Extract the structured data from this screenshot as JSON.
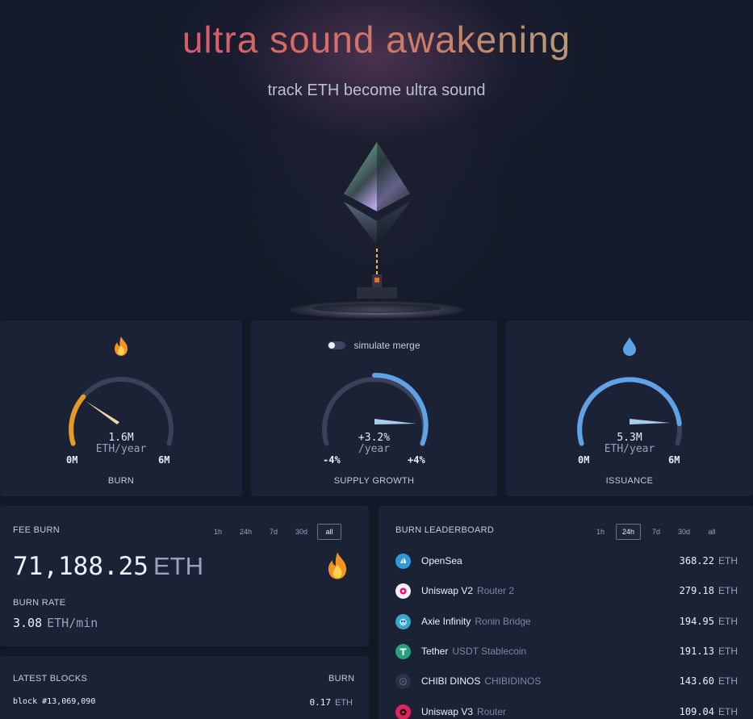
{
  "hero": {
    "title": "ultra sound awakening",
    "subtitle": "track ETH become ultra sound"
  },
  "burn_gauge": {
    "icon": "flame-icon",
    "value": "1.6M",
    "unit": "ETH/year",
    "min": "0M",
    "max": "6M",
    "label": "BURN",
    "fill_fraction": 0.27,
    "color": "#e79a22"
  },
  "supply_gauge": {
    "toggle_label": "simulate merge",
    "toggle_on": false,
    "value": "+3.2%",
    "unit": "/year",
    "min": "-4%",
    "max": "+4%",
    "label": "SUPPLY GROWTH",
    "fill_fraction": 0.9,
    "color": "#5fa2e6"
  },
  "issuance_gauge": {
    "icon": "droplet-icon",
    "value": "5.3M",
    "unit": "ETH/year",
    "min": "0M",
    "max": "6M",
    "label": "ISSUANCE",
    "fill_fraction": 0.88,
    "color": "#5fa2e6"
  },
  "fee_burn": {
    "title": "FEE BURN",
    "periods": [
      "1h",
      "24h",
      "7d",
      "30d",
      "all"
    ],
    "active_period": "all",
    "amount": "71,188.25",
    "amount_unit": "ETH",
    "burn_rate_label": "BURN RATE",
    "burn_rate_value": "3.08",
    "burn_rate_unit": "ETH/min",
    "icon": "flame-icon"
  },
  "leaderboard": {
    "title": "BURN LEADERBOARD",
    "periods": [
      "1h",
      "24h",
      "7d",
      "30d",
      "all"
    ],
    "active_period": "24h",
    "rows": [
      {
        "name": "OpenSea",
        "detail": "",
        "amount": "368.22",
        "unit": "ETH",
        "icon": "opensea-icon",
        "color": "#2d9bd8"
      },
      {
        "name": "Uniswap V2",
        "detail": "Router 2",
        "amount": "279.18",
        "unit": "ETH",
        "icon": "uniswap-icon",
        "color": "#f4f0f5"
      },
      {
        "name": "Axie Infinity",
        "detail": "Ronin Bridge",
        "amount": "194.95",
        "unit": "ETH",
        "icon": "axie-icon",
        "color": "#3aa6c9"
      },
      {
        "name": "Tether",
        "detail": "USDT Stablecoin",
        "amount": "191.13",
        "unit": "ETH",
        "icon": "tether-icon",
        "color": "#26a17b"
      },
      {
        "name": "CHIBI DINOS",
        "detail": "CHIBIDINOS",
        "amount": "143.60",
        "unit": "ETH",
        "icon": "chibi-dinos-icon",
        "color": "#2b3146"
      },
      {
        "name": "Uniswap V3",
        "detail": "Router",
        "amount": "109.04",
        "unit": "ETH",
        "icon": "uniswap-icon",
        "color": "#e0245e"
      }
    ]
  },
  "latest_blocks": {
    "title": "LATEST BLOCKS",
    "burn_header": "BURN",
    "rows": [
      {
        "block": "block #13,069,090",
        "burn": "0.17",
        "unit": "ETH"
      }
    ]
  }
}
